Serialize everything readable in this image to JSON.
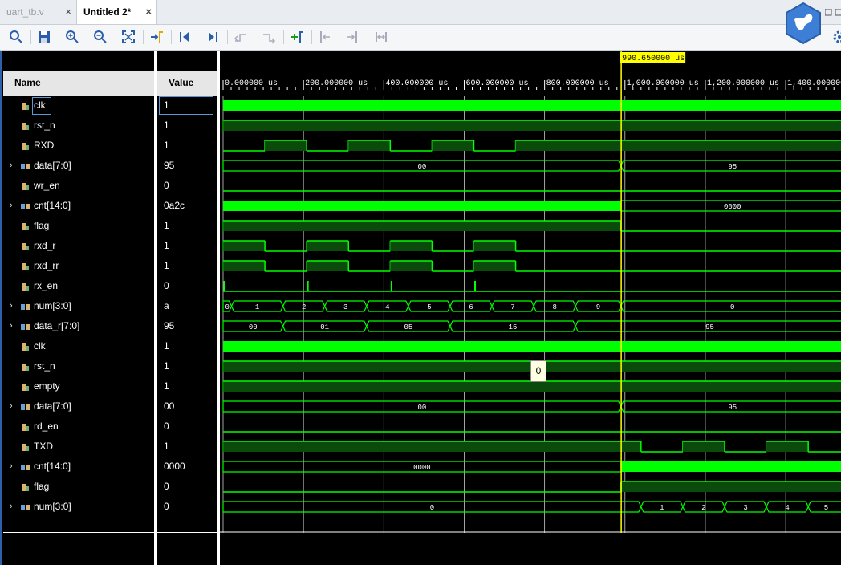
{
  "tabs": [
    {
      "label": "uart_tb.v",
      "close": "×",
      "active": false
    },
    {
      "label": "Untitled 2*",
      "close": "×",
      "active": true
    }
  ],
  "toolbar": [
    {
      "icon": "search-icon",
      "label": ""
    },
    {
      "icon": "save-icon",
      "label": ""
    },
    {
      "icon": "zoom-in-icon",
      "label": ""
    },
    {
      "icon": "zoom-out-icon",
      "label": ""
    },
    {
      "icon": "zoom-fit-icon",
      "label": ""
    },
    {
      "icon": "go-to-cursor-icon",
      "label": ""
    },
    {
      "icon": "go-to-start-icon",
      "label": ""
    },
    {
      "icon": "go-to-end-icon",
      "label": ""
    },
    {
      "icon": "previous-transition-icon",
      "label": ""
    },
    {
      "icon": "next-transition-icon",
      "label": ""
    },
    {
      "icon": "add-marker-icon",
      "label": ""
    },
    {
      "icon": "previous-marker-icon",
      "label": ""
    },
    {
      "icon": "next-marker-icon",
      "label": ""
    },
    {
      "icon": "swap-cursors-icon",
      "label": ""
    }
  ],
  "columns": {
    "name": "Name",
    "value": "Value"
  },
  "cursor": {
    "label": "990.650000 us",
    "time_us": 990.65
  },
  "timeline": {
    "ticks": [
      "0.000000 us",
      "200.000000 us",
      "400.000000 us",
      "600.000000 us",
      "800.000000 us",
      "1,000.000000 us",
      "1,200.000000 us",
      "1,400.000000"
    ]
  },
  "signals": [
    {
      "name": "clk",
      "value": "1",
      "kind": "bit",
      "expand": false
    },
    {
      "name": "rst_n",
      "value": "1",
      "kind": "bit",
      "expand": false
    },
    {
      "name": "RXD",
      "value": "1",
      "kind": "bit",
      "expand": false
    },
    {
      "name": "data[7:0]",
      "value": "95",
      "kind": "bus",
      "expand": true
    },
    {
      "name": "wr_en",
      "value": "0",
      "kind": "bit",
      "expand": false
    },
    {
      "name": "cnt[14:0]",
      "value": "0a2c",
      "kind": "bus",
      "expand": true
    },
    {
      "name": "flag",
      "value": "1",
      "kind": "bit",
      "expand": false
    },
    {
      "name": "rxd_r",
      "value": "1",
      "kind": "bit",
      "expand": false
    },
    {
      "name": "rxd_rr",
      "value": "1",
      "kind": "bit",
      "expand": false
    },
    {
      "name": "rx_en",
      "value": "0",
      "kind": "bit",
      "expand": false
    },
    {
      "name": "num[3:0]",
      "value": "a",
      "kind": "bus",
      "expand": true
    },
    {
      "name": "data_r[7:0]",
      "value": "95",
      "kind": "bus",
      "expand": true
    },
    {
      "name": "clk",
      "value": "1",
      "kind": "bit",
      "expand": false
    },
    {
      "name": "rst_n",
      "value": "1",
      "kind": "bit",
      "expand": false
    },
    {
      "name": "empty",
      "value": "1",
      "kind": "bit",
      "expand": false
    },
    {
      "name": "data[7:0]",
      "value": "00",
      "kind": "bus",
      "expand": true
    },
    {
      "name": "rd_en",
      "value": "0",
      "kind": "bit",
      "expand": false
    },
    {
      "name": "TXD",
      "value": "1",
      "kind": "bit",
      "expand": false
    },
    {
      "name": "cnt[14:0]",
      "value": "0000",
      "kind": "bus",
      "expand": true
    },
    {
      "name": "flag",
      "value": "0",
      "kind": "bit",
      "expand": false
    },
    {
      "name": "num[3:0]",
      "value": "0",
      "kind": "bus",
      "expand": true
    }
  ],
  "bus_labels": {
    "r3": [
      {
        "t": "00"
      },
      {
        "t": "95"
      }
    ],
    "r5": [
      {
        "t": "0000"
      }
    ],
    "r10": [
      {
        "t": "0"
      },
      {
        "t": "1"
      },
      {
        "t": "2"
      },
      {
        "t": "3"
      },
      {
        "t": "4"
      },
      {
        "t": "5"
      },
      {
        "t": "6"
      },
      {
        "t": "7"
      },
      {
        "t": "8"
      },
      {
        "t": "9"
      },
      {
        "t": "0"
      }
    ],
    "r11": [
      {
        "t": "00"
      },
      {
        "t": "01"
      },
      {
        "t": "05"
      },
      {
        "t": "15"
      },
      {
        "t": "95"
      }
    ],
    "r15": [
      {
        "t": "00"
      },
      {
        "t": "95"
      }
    ],
    "r18": [
      {
        "t": "0000"
      }
    ],
    "r20": [
      {
        "t": "0"
      },
      {
        "t": "1"
      },
      {
        "t": "2"
      },
      {
        "t": "3"
      },
      {
        "t": "4"
      },
      {
        "t": "5"
      }
    ]
  },
  "tooltip": {
    "text": "0"
  },
  "colors": {
    "wave": "#00ff00",
    "wave_dark": "#0a4a0a",
    "cursor": "#ffff00",
    "background": "#000000"
  }
}
